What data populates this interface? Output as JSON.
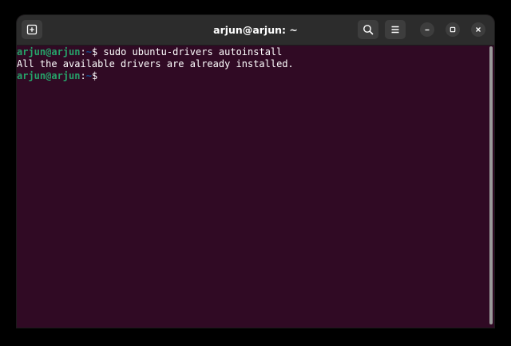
{
  "window": {
    "title": "arjun@arjun: ~"
  },
  "colors": {
    "terminal_bg": "#300a24",
    "titlebar_bg": "#2c2c2c",
    "prompt_user": "#26a269",
    "prompt_path": "#12488b",
    "text": "#ffffff"
  },
  "icons": {
    "new_tab": "new-tab-icon",
    "search": "search-icon",
    "menu": "hamburger-menu-icon",
    "minimize": "minimize-icon",
    "maximize": "maximize-icon",
    "close": "close-icon"
  },
  "terminal": {
    "lines": [
      {
        "user_host": "arjun@arjun",
        "separator": ":",
        "path": "~",
        "prompt_symbol": "$ ",
        "command": "sudo ubuntu-drivers autoinstall"
      },
      {
        "output": "All the available drivers are already installed."
      },
      {
        "user_host": "arjun@arjun",
        "separator": ":",
        "path": "~",
        "prompt_symbol": "$ ",
        "command": ""
      }
    ]
  }
}
